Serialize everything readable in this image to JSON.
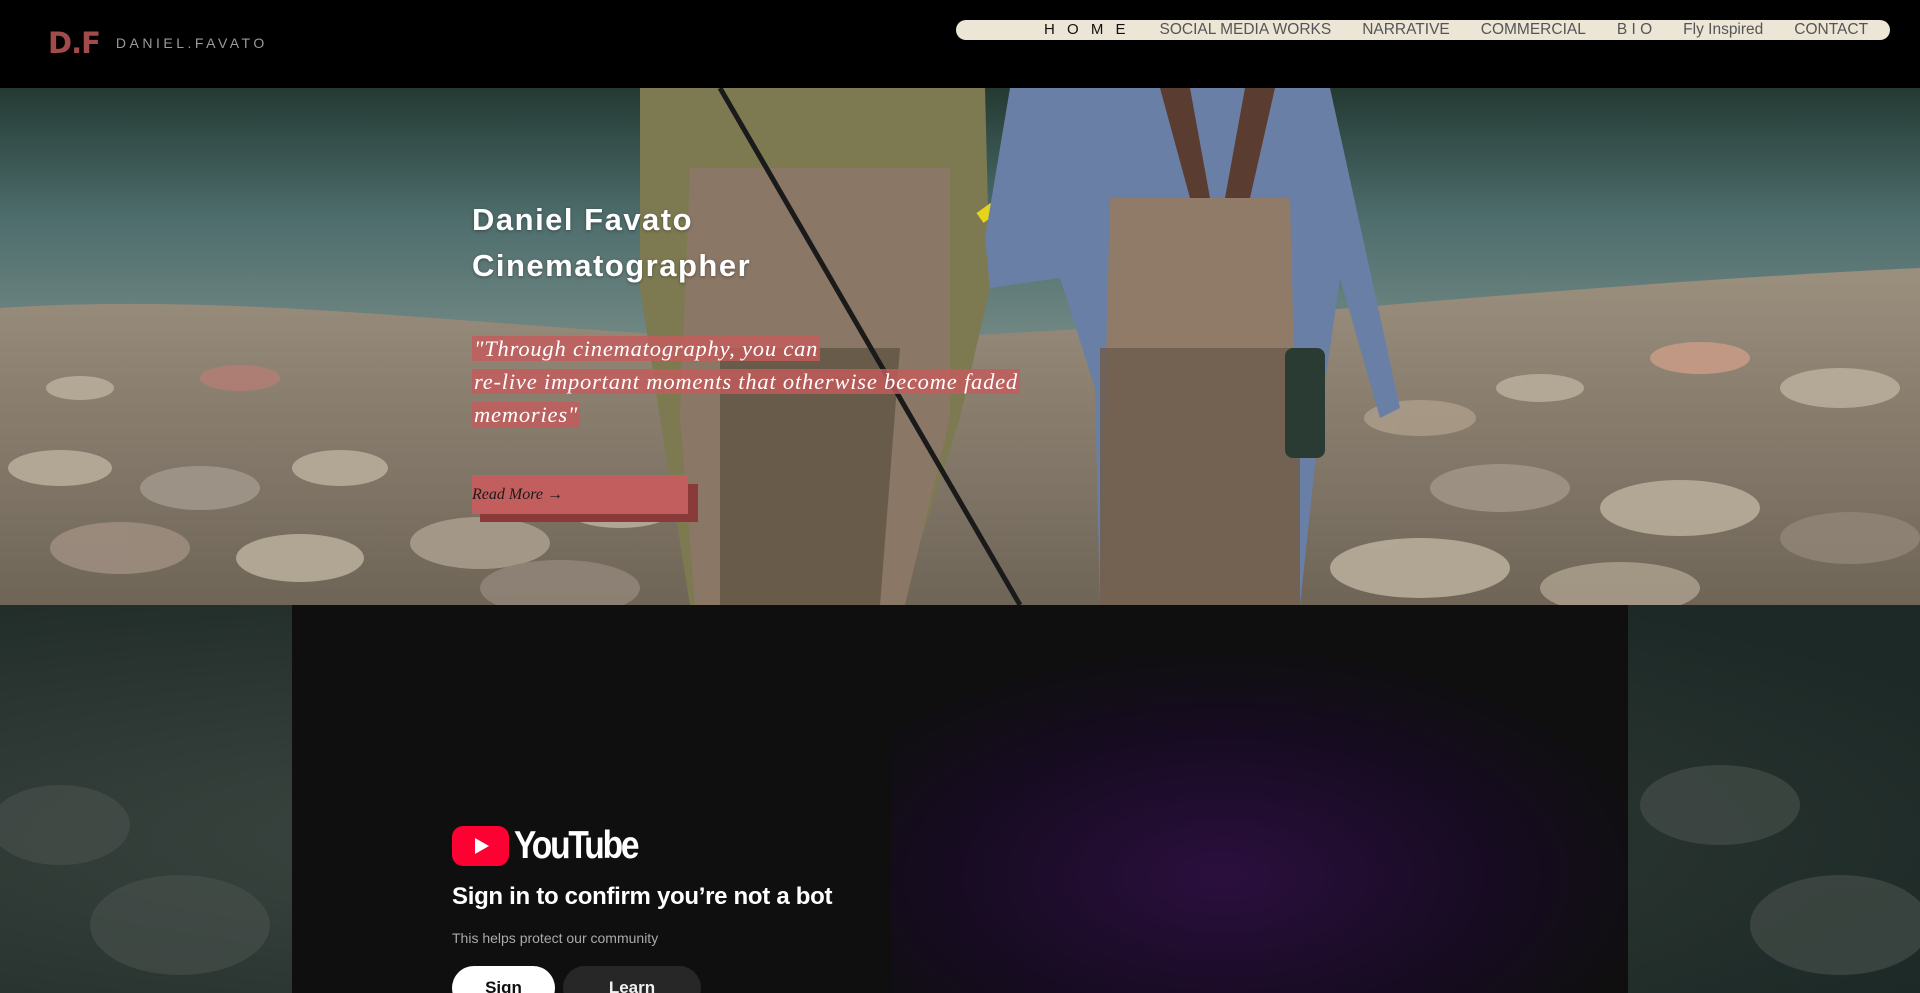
{
  "header": {
    "logo_mark": "D.F",
    "logo_text": "DANIEL.FAVATO",
    "nav": [
      {
        "label": "H O M E",
        "active": true
      },
      {
        "label": "SOCIAL MEDIA WORKS",
        "active": false
      },
      {
        "label": "NARRATIVE",
        "active": false
      },
      {
        "label": "COMMERCIAL",
        "active": false
      },
      {
        "label": "B I O",
        "active": false
      },
      {
        "label": "Fly Inspired",
        "active": false
      },
      {
        "label": "CONTACT",
        "active": false
      }
    ]
  },
  "hero": {
    "title": "Daniel Favato",
    "subtitle": "Cinematographer",
    "quote_lines": [
      "\"Through cinematography, you can",
      "re-live important moments that otherwise become faded",
      "memories\""
    ],
    "read_more_label": "Read More →"
  },
  "embed": {
    "brand": "YouTube",
    "heading": "Sign in to confirm you’re not a bot",
    "subtext": "This helps protect our community",
    "signin_label": "Sign in",
    "learn_more_label": "Learn more"
  },
  "colors": {
    "accent": "#c25e5e",
    "logo": "#a24b4b",
    "nav_bg": "#ece6d6",
    "youtube_red": "#ff0033"
  }
}
